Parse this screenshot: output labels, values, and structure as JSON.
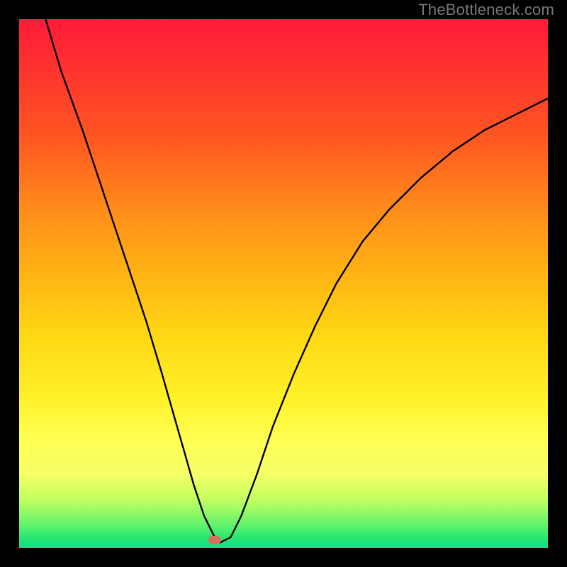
{
  "watermark": "TheBottleneck.com",
  "chart_data": {
    "type": "line",
    "title": "",
    "xlabel": "",
    "ylabel": "",
    "xlim": [
      0,
      100
    ],
    "ylim": [
      0,
      100
    ],
    "series": [
      {
        "name": "curve",
        "x": [
          5,
          8,
          12,
          16,
          20,
          24,
          27,
          29,
          31,
          33,
          35,
          37,
          38,
          40,
          42,
          45,
          48,
          52,
          56,
          60,
          65,
          70,
          76,
          82,
          88,
          94,
          100
        ],
        "y": [
          100,
          90,
          79,
          67,
          55,
          43,
          33,
          26,
          19,
          12,
          6,
          2,
          1,
          2,
          6,
          14,
          23,
          33,
          42,
          50,
          58,
          64,
          70,
          75,
          79,
          82,
          85
        ]
      }
    ],
    "marker": {
      "x_pct": 37,
      "y_pct": 1.5
    },
    "background_gradient": {
      "top": "#ff1a3a",
      "bottom": "#0de088"
    }
  }
}
